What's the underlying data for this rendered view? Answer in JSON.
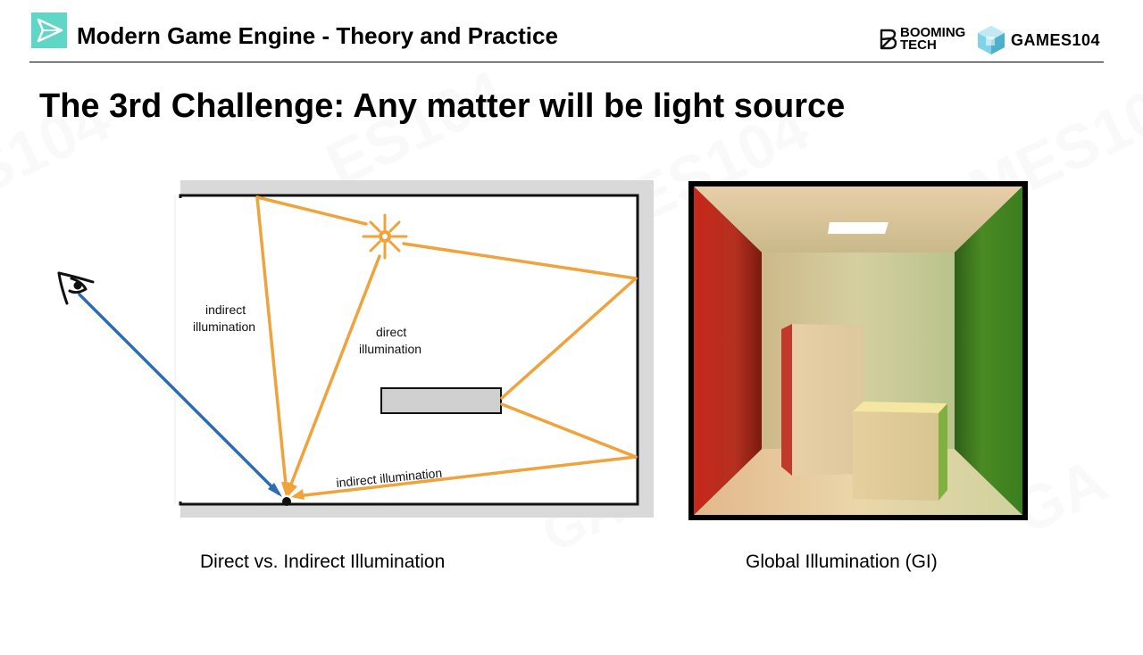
{
  "header": {
    "title": "Modern Game Engine - Theory and Practice",
    "brand_booming_line1": "BOOMING",
    "brand_booming_line2": "TECH",
    "brand_games": "GAMES104"
  },
  "slide": {
    "title": "The 3rd Challenge: Any matter will be light source"
  },
  "diagram_left": {
    "label_indirect_top_line1": "indirect",
    "label_indirect_top_line2": "illumination",
    "label_direct_line1": "direct",
    "label_direct_line2": "illumination",
    "label_indirect_bottom": "indirect illumination",
    "caption": "Direct vs. Indirect Illumination"
  },
  "diagram_right": {
    "caption": "Global Illumination (GI)"
  },
  "colors": {
    "orange_ray": "#f0a23c",
    "blue_ray": "#2a6db5",
    "box_gray": "#cfcfcf",
    "cornell_red": "#b02818",
    "cornell_green": "#3f7d1f"
  }
}
